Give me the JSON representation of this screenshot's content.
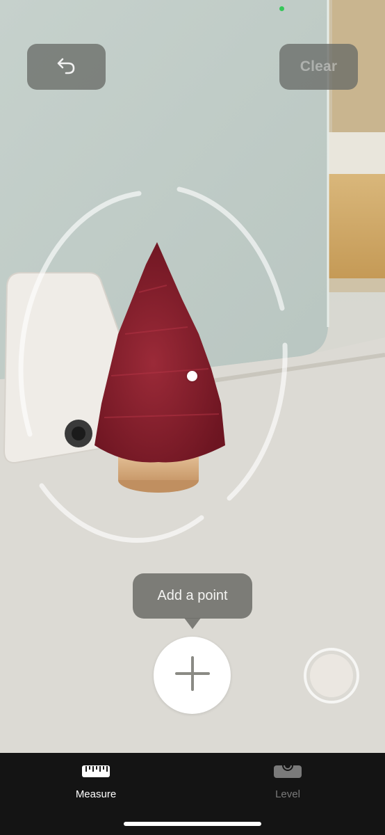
{
  "top_bar": {
    "undo_icon": "undo-arrow-icon",
    "clear_label": "Clear"
  },
  "camera": {
    "scene": "tabletop-christmas-tree"
  },
  "hint": {
    "text": "Add a point"
  },
  "controls": {
    "add_icon": "plus-icon",
    "shutter_icon": "shutter-icon"
  },
  "tabs": [
    {
      "label": "Measure",
      "icon": "ruler-icon",
      "selected": true
    },
    {
      "label": "Level",
      "icon": "level-icon",
      "selected": false
    }
  ],
  "colors": {
    "status_indicator": "#35c759",
    "tab_selected": "#ffffff",
    "tab_unselected": "#7a7a7a",
    "tab_bar_background": "#141414",
    "tree": "#8c1f2e"
  }
}
